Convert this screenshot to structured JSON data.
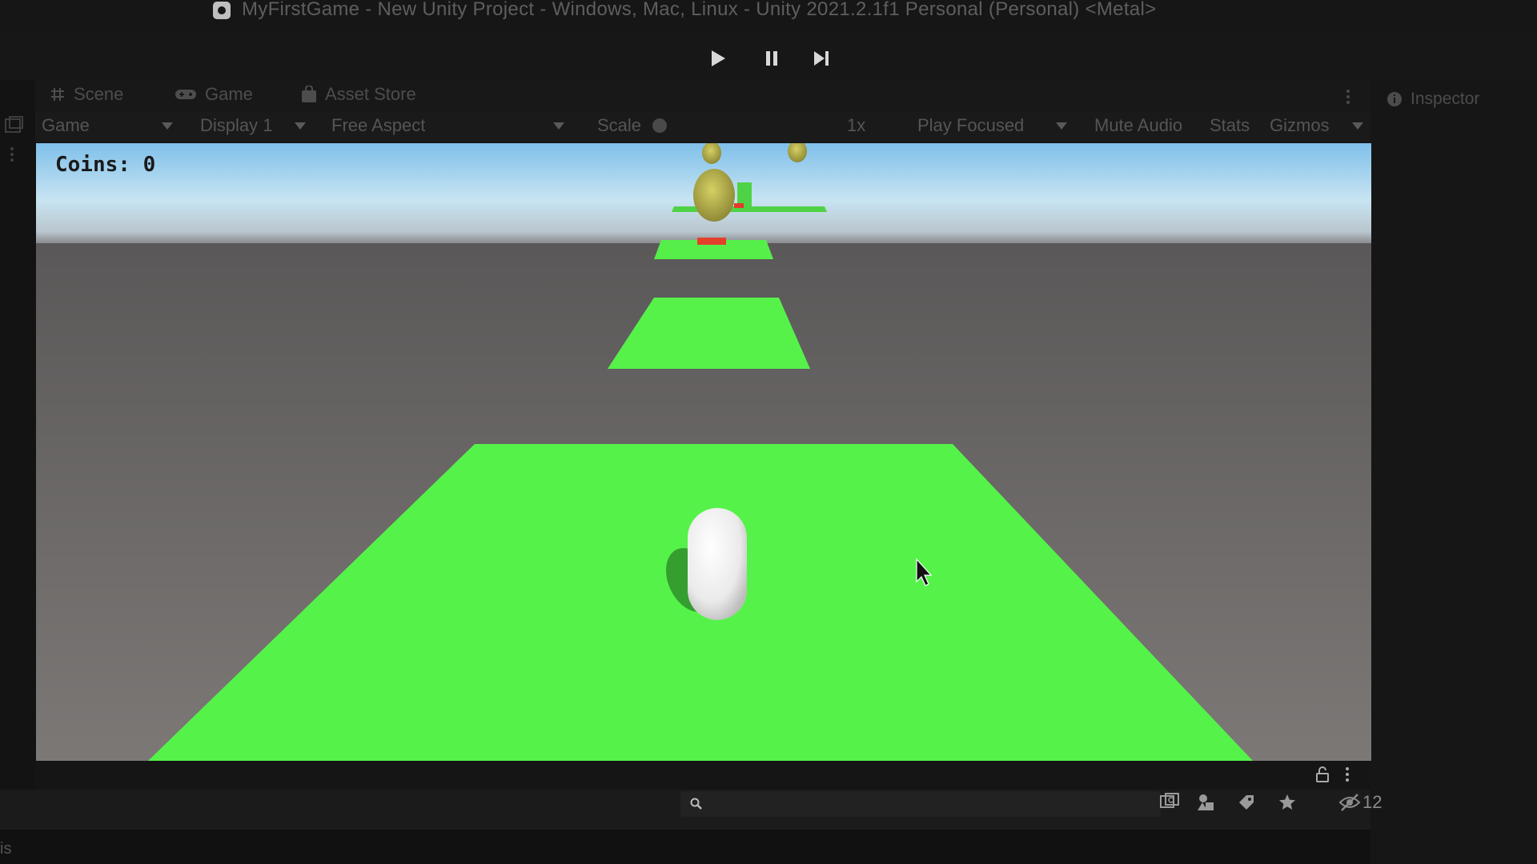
{
  "window": {
    "title": "MyFirstGame - New Unity Project - Windows, Mac, Linux - Unity 2021.2.1f1 Personal (Personal) <Metal>"
  },
  "toolbar": {
    "play_icon": "play-icon",
    "pause_icon": "pause-icon",
    "step_icon": "step-icon"
  },
  "tabs": [
    {
      "label": "Scene",
      "icon": "grid-icon"
    },
    {
      "label": "Game",
      "icon": "gamepad-icon"
    },
    {
      "label": "Asset Store",
      "icon": "store-bag-icon"
    }
  ],
  "inspector": {
    "label": "Inspector",
    "icon": "info-icon"
  },
  "game_toolbar": {
    "mode": "Game",
    "display": "Display 1",
    "aspect": "Free Aspect",
    "scale_label": "Scale",
    "scale_value": "1x",
    "play_mode": "Play Focused",
    "mute_audio": "Mute Audio",
    "stats": "Stats",
    "gizmos": "Gizmos"
  },
  "hud": {
    "coins_label": "Coins:",
    "coins_value": "0"
  },
  "bottom_toolbar": {
    "search_placeholder": "",
    "hidden_count": "12"
  },
  "corner_label": "is",
  "colors": {
    "platform_green": "#55f24a",
    "ground_gray": "#6e6a68",
    "sky_blue": "#9fd3f0",
    "coin_yellow": "#b7b34f",
    "player_white": "#f2f2f2",
    "editor_dark": "#181818"
  }
}
